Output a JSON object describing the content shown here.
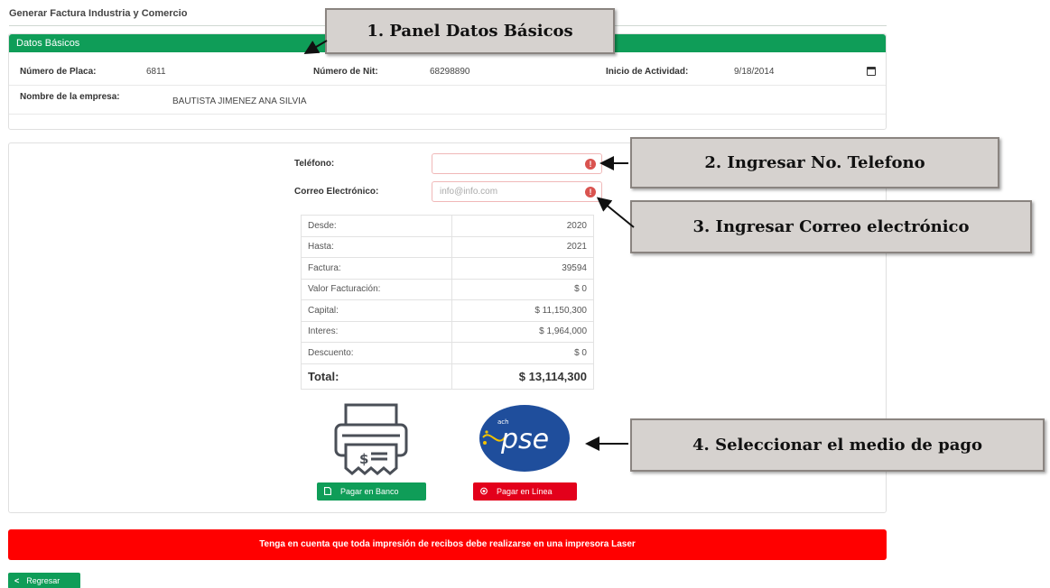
{
  "page": {
    "title": "Generar Factura Industria y Comercio"
  },
  "datos_basicos": {
    "header": "Datos Básicos",
    "placa_label": "Número de Placa:",
    "placa_value": "6811",
    "nit_label": "Número de Nit:",
    "nit_value": "68298890",
    "inicio_label": "Inicio de Actividad:",
    "inicio_value": "9/18/2014",
    "empresa_label": "Nombre de la empresa:",
    "empresa_value": "BAUTISTA JIMENEZ ANA SILVIA"
  },
  "form": {
    "telefono_label": "Teléfono:",
    "telefono_value": "",
    "correo_label": "Correo Electrónico:",
    "correo_placeholder": "info@info.com",
    "error_glyph": "!"
  },
  "summary": {
    "rows": [
      {
        "label": "Desde:",
        "value": "2020"
      },
      {
        "label": "Hasta:",
        "value": "2021"
      },
      {
        "label": "Factura:",
        "value": "39594"
      },
      {
        "label": "Valor Facturación:",
        "value": "$ 0"
      },
      {
        "label": "Capital:",
        "value": "$ 11,150,300"
      },
      {
        "label": "Interes:",
        "value": "$ 1,964,000"
      },
      {
        "label": "Descuento:",
        "value": "$ 0"
      }
    ],
    "total_label": "Total:",
    "total_value": "$ 13,114,300"
  },
  "payment": {
    "bank_button": "Pagar en Banco",
    "online_button": "Pagar en Línea",
    "pse_logo_text": "pse",
    "pse_logo_small": "ach"
  },
  "warning": "Tenga en cuenta que toda impresión de recibos debe realizarse en una impresora Laser",
  "back_button": "Regresar",
  "callouts": {
    "c1": "1. Panel Datos Básicos",
    "c2": "2. Ingresar No. Telefono",
    "c3": "3. Ingresar Correo electrónico",
    "c4": "4. Seleccionar el medio de pago"
  },
  "colors": {
    "green": "#0f9d58",
    "red": "#ff0000",
    "error": "#d9534f",
    "pse_blue": "#1f4e9c"
  }
}
